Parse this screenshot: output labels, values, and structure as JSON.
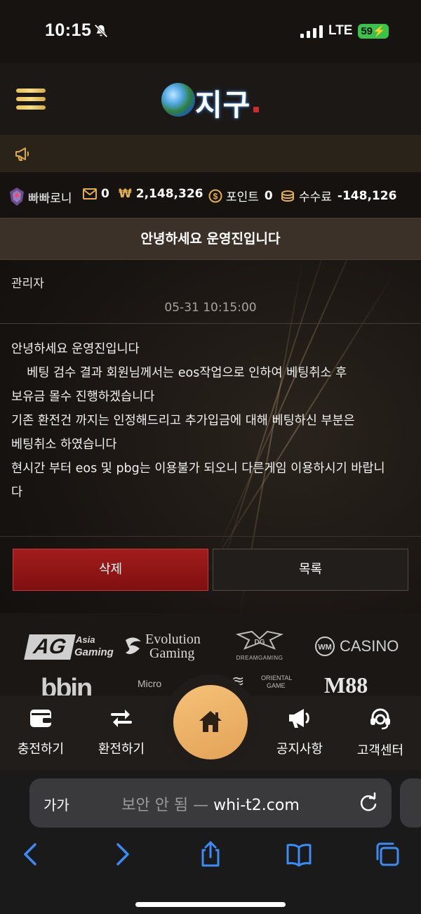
{
  "status_bar": {
    "time": "10:15",
    "network": "LTE",
    "battery": "59"
  },
  "header": {
    "logo_text": "지구"
  },
  "user": {
    "nickname": "빠빠로니",
    "messages": "0",
    "currency_symbol": "₩",
    "balance": "2,148,326",
    "points_label": "포인트",
    "points": "0",
    "fee_label": "수수료",
    "fee": "-148,126"
  },
  "post": {
    "title": "안녕하세요 운영진입니다",
    "author": "관리자",
    "date": "05-31 10:15:00",
    "body": "안녕하세요 운영진입니다\n    베팅 검수 결과 회원님께서는 eos작업으로 인하여 베팅취소 후\n보유금 몰수 진행하겠습니다\n기존 환전건 까지는 인정해드리고 추가입금에 대해 베팅하신 부분은\n베팅취소 하였습니다\n현시간 부터 eos 및 pbg는 이용불가 되오니 다른게임 이용하시기 바랍니\n다"
  },
  "buttons": {
    "delete": "삭제",
    "list": "목록"
  },
  "providers": {
    "ag_main": "AG",
    "ag_sub1": "Asia",
    "ag_sub2": "Gaming",
    "evo1": "Evolution",
    "evo2": "Gaming",
    "dream": "DREAMGAMING",
    "casino": "CASINO",
    "bbin": "bbin",
    "micro": "Micro",
    "oriental1": "ORIENTAL",
    "oriental2": "GAME",
    "m88": "M88"
  },
  "bottom_nav": [
    {
      "label": "충전하기",
      "icon": "wallet-icon"
    },
    {
      "label": "환전하기",
      "icon": "exchange-icon"
    },
    {
      "label": "",
      "icon": "home-icon"
    },
    {
      "label": "공지사항",
      "icon": "megaphone-icon"
    },
    {
      "label": "고객센터",
      "icon": "headset-icon"
    }
  ],
  "browser": {
    "aa": "가가",
    "security": "보안 안 됨 —",
    "domain": "whi-t2.com"
  },
  "colors": {
    "gold": "#e2b04d",
    "delete_red": "#9b1a1a",
    "home_orange": "#eeb066"
  }
}
